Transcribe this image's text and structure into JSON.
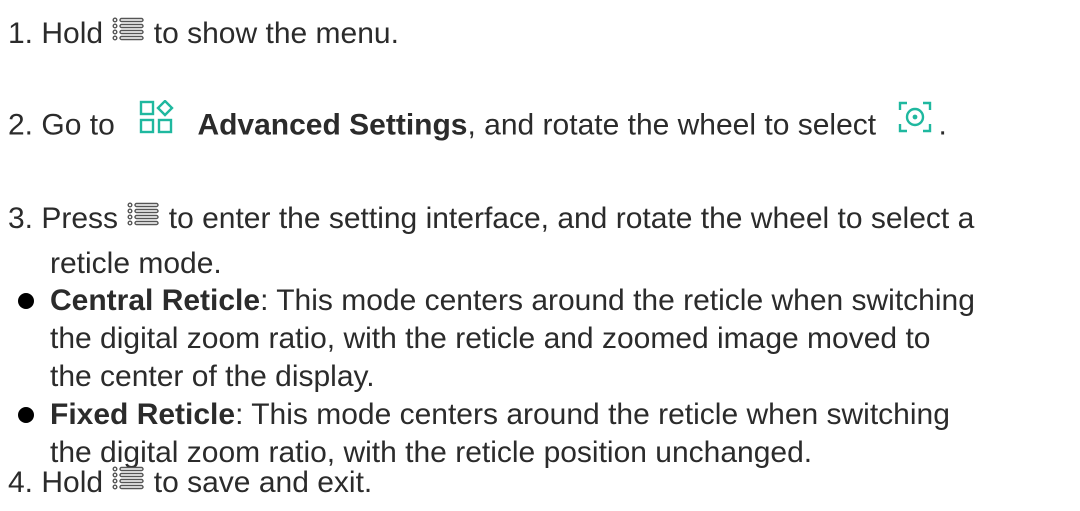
{
  "accent_color": "#1fb89f",
  "steps": [
    {
      "num": "1.",
      "pre": "Hold",
      "icon1": "menu-button-icon",
      "post": "to show the menu."
    },
    {
      "num": "2.",
      "pre": "Go to",
      "icon1": "advanced-settings-icon",
      "bold": "Advanced Settings",
      "mid": ", and rotate the wheel to select",
      "icon2": "reticle-focus-icon",
      "post": "."
    },
    {
      "num": "3.",
      "pre": "Press",
      "icon1": "menu-button-icon",
      "post_line1": "to enter the setting interface, and rotate the wheel to select a",
      "post_line2": "reticle mode."
    },
    {
      "num": "4.",
      "pre": "Hold",
      "icon1": "menu-button-icon",
      "post": "to save and exit."
    }
  ],
  "bullets": [
    {
      "title": "Central Reticle",
      "sep": ":",
      "line1": " This mode centers around the reticle when switching",
      "line2": "the digital zoom ratio, with the reticle and zoomed image moved to",
      "line3": "the center of the display."
    },
    {
      "title": "Fixed Reticle",
      "sep": ":",
      "line1": " This mode centers around the reticle when switching",
      "line2": "the digital zoom ratio, with the reticle position unchanged."
    }
  ]
}
